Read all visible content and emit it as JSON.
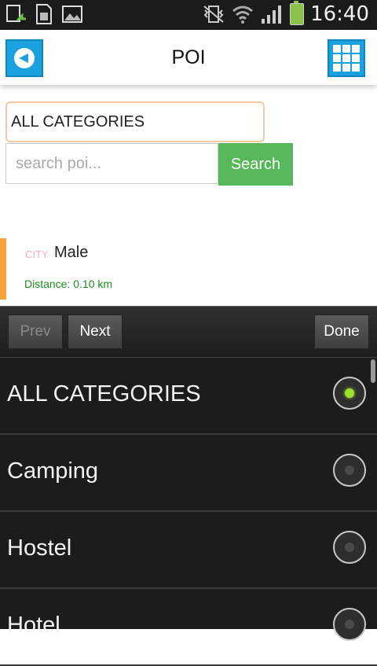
{
  "status_bar": {
    "time": "16:40",
    "left_icons": [
      "upload-icon",
      "sim-card-icon",
      "image-icon"
    ],
    "right_icons": [
      "vibrate-icon",
      "wifi-icon",
      "signal-icon",
      "battery-icon"
    ]
  },
  "header": {
    "title": "POI",
    "back_icon": "back-arrow-icon",
    "grid_icon": "grid-menu-icon"
  },
  "search": {
    "category_value": "ALL CATEGORIES",
    "placeholder": "search poi...",
    "button_label": "Search"
  },
  "poi_list": [
    {
      "category": "CITY",
      "name": "Male",
      "distance": "Distance: 0.10 km"
    }
  ],
  "picker": {
    "prev_label": "Prev",
    "next_label": "Next",
    "done_label": "Done",
    "options": [
      {
        "label": "ALL CATEGORIES",
        "selected": true
      },
      {
        "label": "Camping",
        "selected": false
      },
      {
        "label": "Hostel",
        "selected": false
      },
      {
        "label": "Hotel",
        "selected": false
      }
    ]
  },
  "colors": {
    "accent_blue": "#1aa1e0",
    "search_green": "#56b85a",
    "poi_bar_orange": "#f6a23a",
    "distance_green": "#1e8a1e",
    "radio_selected": "#9be02a"
  }
}
